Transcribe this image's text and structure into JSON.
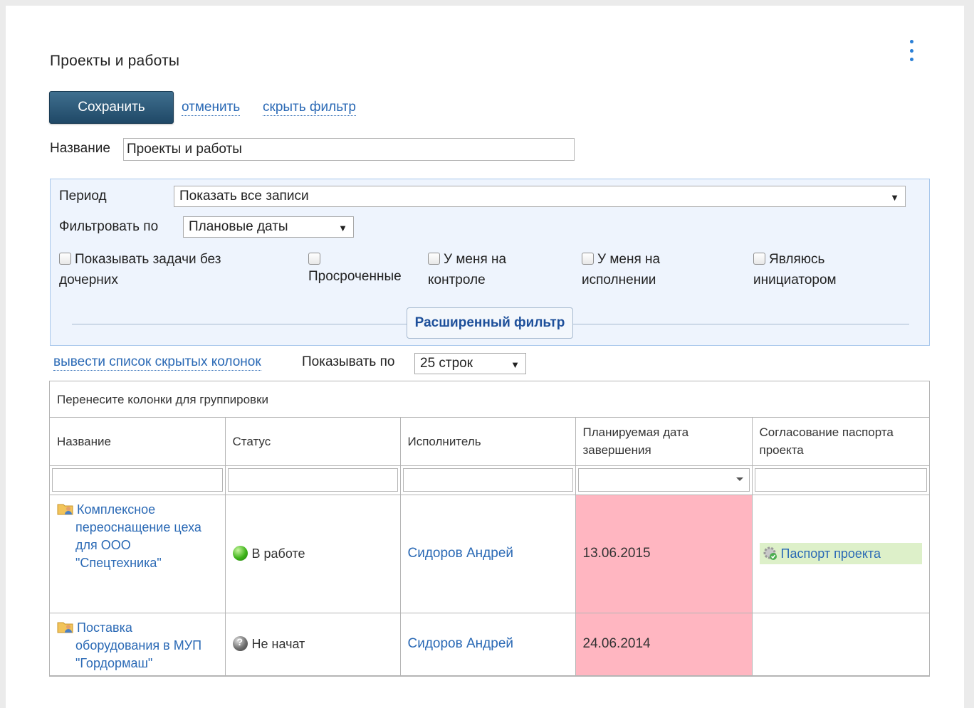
{
  "header": {
    "title": "Проекты и работы",
    "menu_icon": "kebab-menu-icon"
  },
  "toolbar": {
    "save_label": "Сохранить",
    "cancel_label": "отменить",
    "hide_filter_label": "скрыть фильтр"
  },
  "name_field": {
    "label": "Название",
    "value": "Проекты и работы"
  },
  "filter": {
    "period_label": "Период",
    "period_value": "Показать все записи",
    "filter_by_label": "Фильтровать по",
    "filter_by_value": "Плановые даты",
    "checkboxes": [
      {
        "label_line1": "Показывать задачи без",
        "label_line2": "дочерних",
        "checked": false
      },
      {
        "label_line1": "",
        "label_line2": "Просроченные",
        "checked": false
      },
      {
        "label_line1": "У меня на",
        "label_line2": "контроле",
        "checked": false
      },
      {
        "label_line1": "У меня на",
        "label_line2": "исполнении",
        "checked": false
      },
      {
        "label_line1": "Являюсь",
        "label_line2": "инициатором",
        "checked": false
      }
    ],
    "advanced_label": "Расширенный фильтр"
  },
  "list_controls": {
    "hidden_columns_label": "вывести список скрытых колонок",
    "show_by_label": "Показывать по",
    "show_by_value": "25 строк"
  },
  "grid": {
    "group_hint": "Перенесите колонки для группировки",
    "columns": [
      "Название",
      "Статус",
      "Исполнитель",
      "Планируемая дата завершения",
      "Согласование паспорта проекта"
    ],
    "rows": [
      {
        "name": "Комплексное переоснащение цеха для ООО \"Спецтехника\"",
        "status": "В работе",
        "status_icon": "status-in-progress-icon",
        "assignee": "Сидоров Андрей",
        "due_date": "13.06.2015",
        "passport": "Паспорт проекта"
      },
      {
        "name": "Поставка оборудования в МУП \"Гордормаш\"",
        "status": "Не начат",
        "status_icon": "status-not-started-icon",
        "assignee": "Сидоров Андрей",
        "due_date": "24.06.2014",
        "passport": ""
      }
    ]
  },
  "colors": {
    "accent": "#2a69b5",
    "filter_bg": "#eef4fd",
    "overdue_bg": "#ffb6c1",
    "passport_bg": "#ddf0c9"
  }
}
